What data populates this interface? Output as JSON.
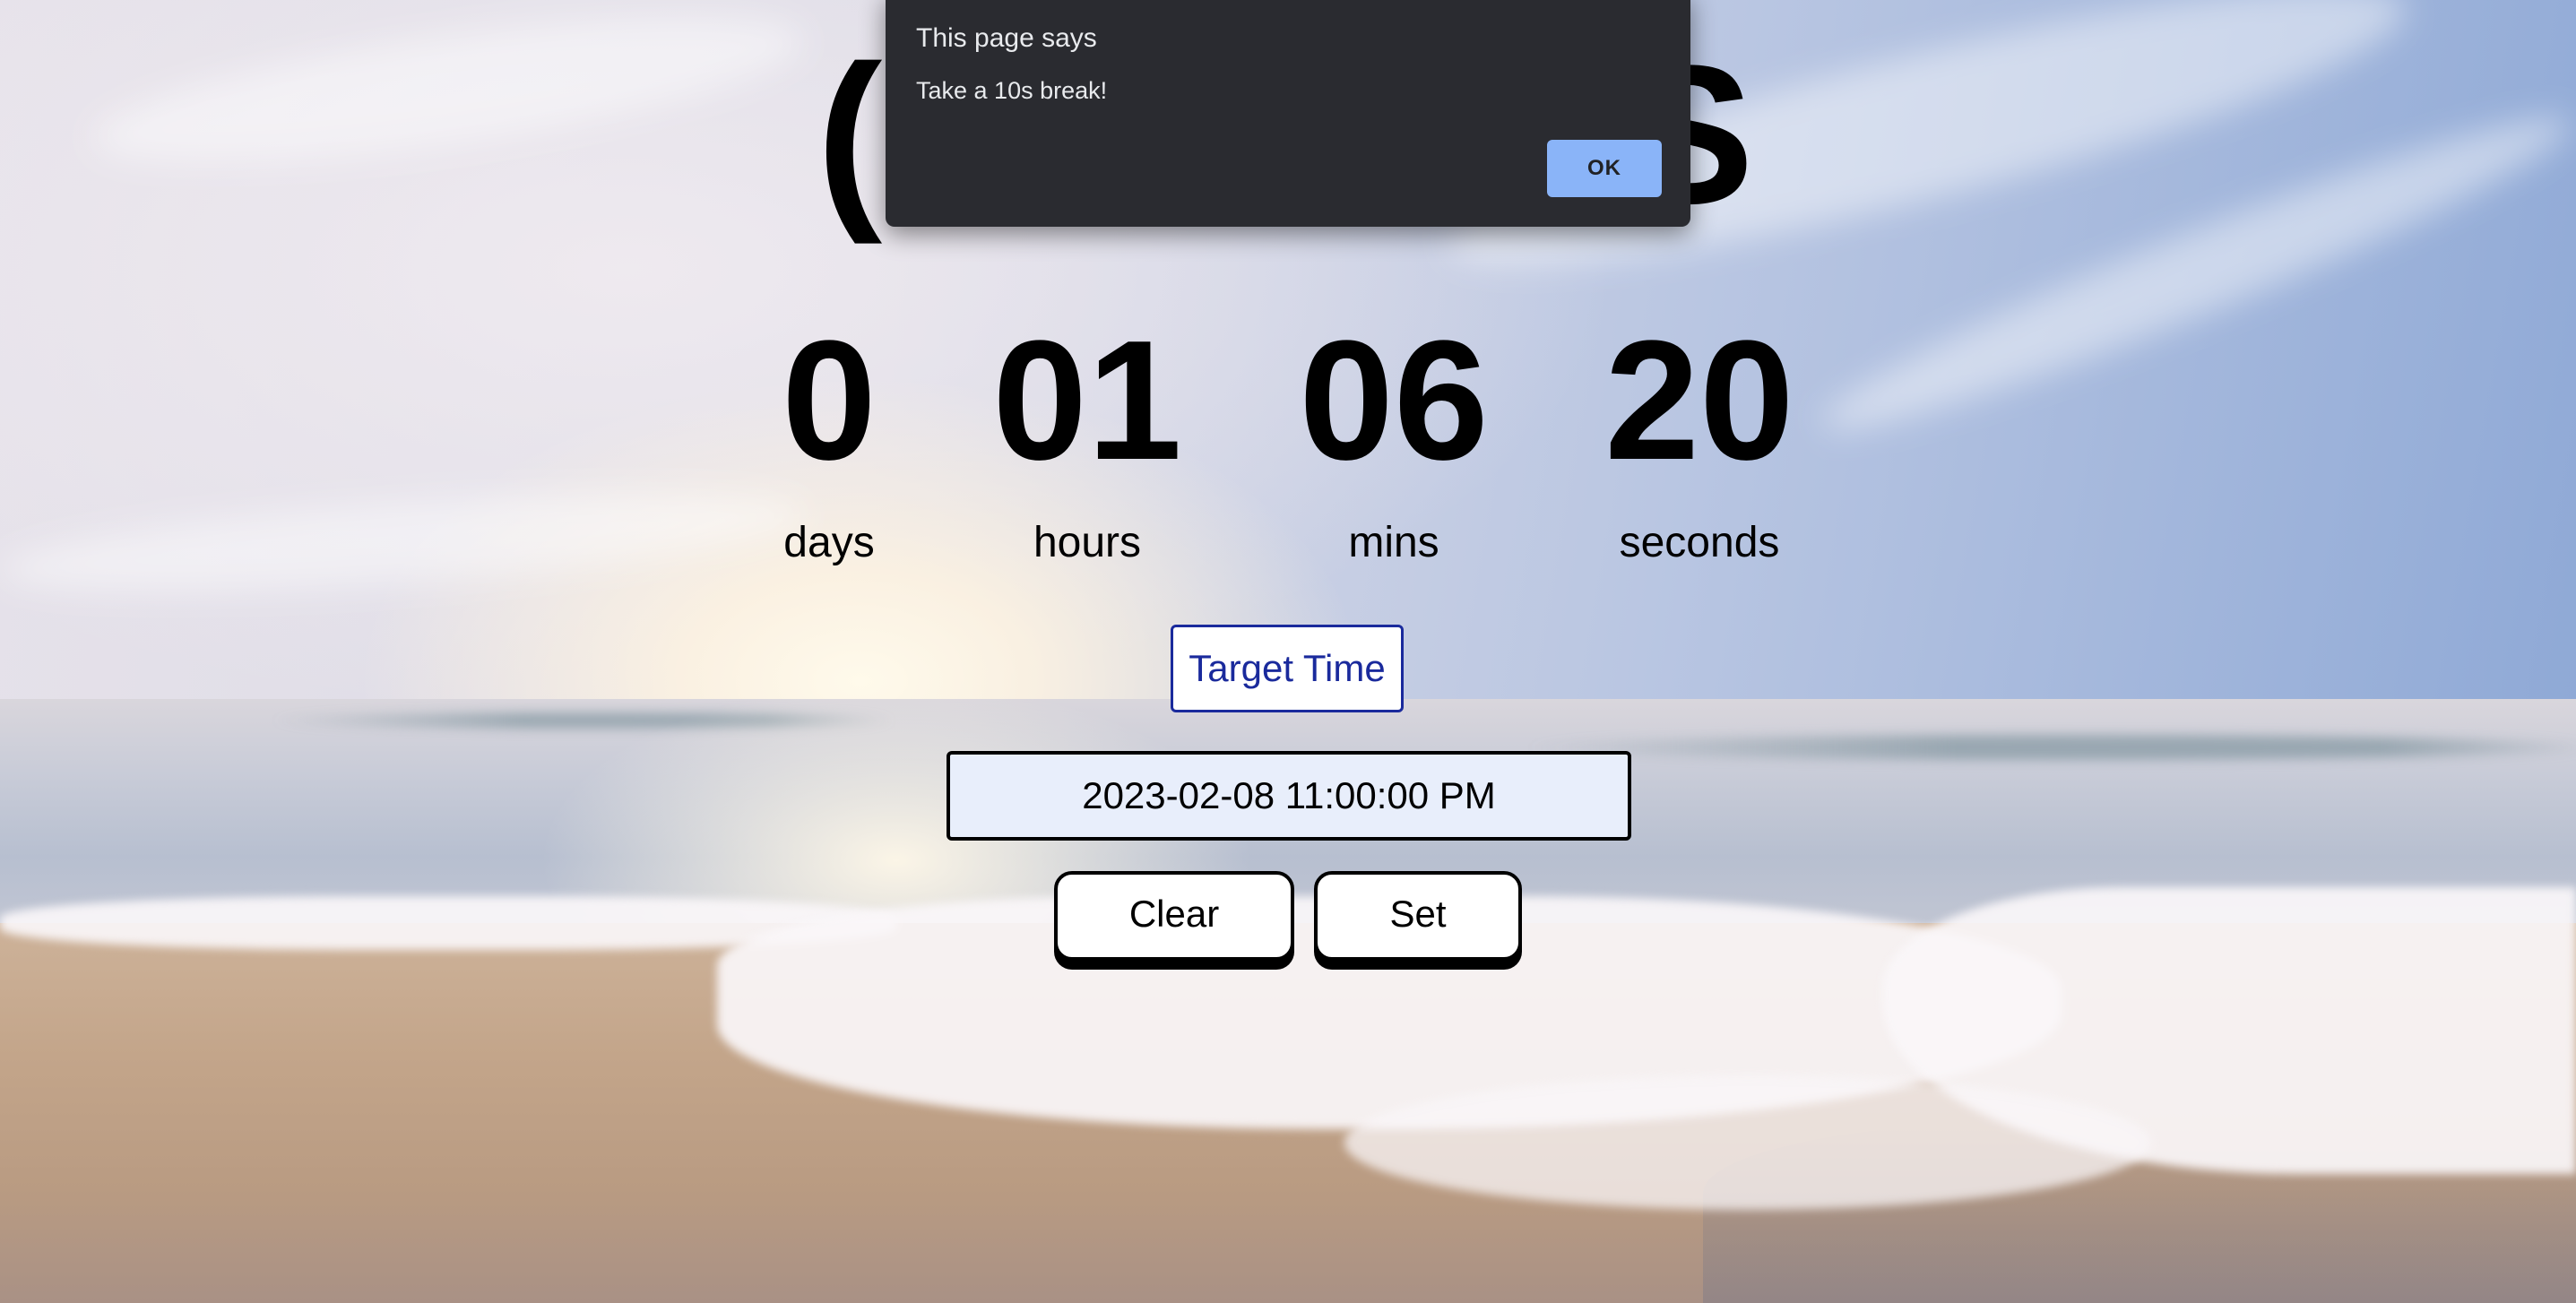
{
  "countdown": {
    "days": {
      "value": "0",
      "label": "days"
    },
    "hours": {
      "value": "01",
      "label": "hours"
    },
    "mins": {
      "value": "06",
      "label": "mins"
    },
    "seconds": {
      "value": "20",
      "label": "seconds"
    }
  },
  "target": {
    "label": "Target Time",
    "value": "2023-02-08 11:00:00 PM"
  },
  "buttons": {
    "clear": "Clear",
    "set": "Set"
  },
  "alert": {
    "title": "This page says",
    "message": "Take a 10s break!",
    "ok": "OK"
  }
}
